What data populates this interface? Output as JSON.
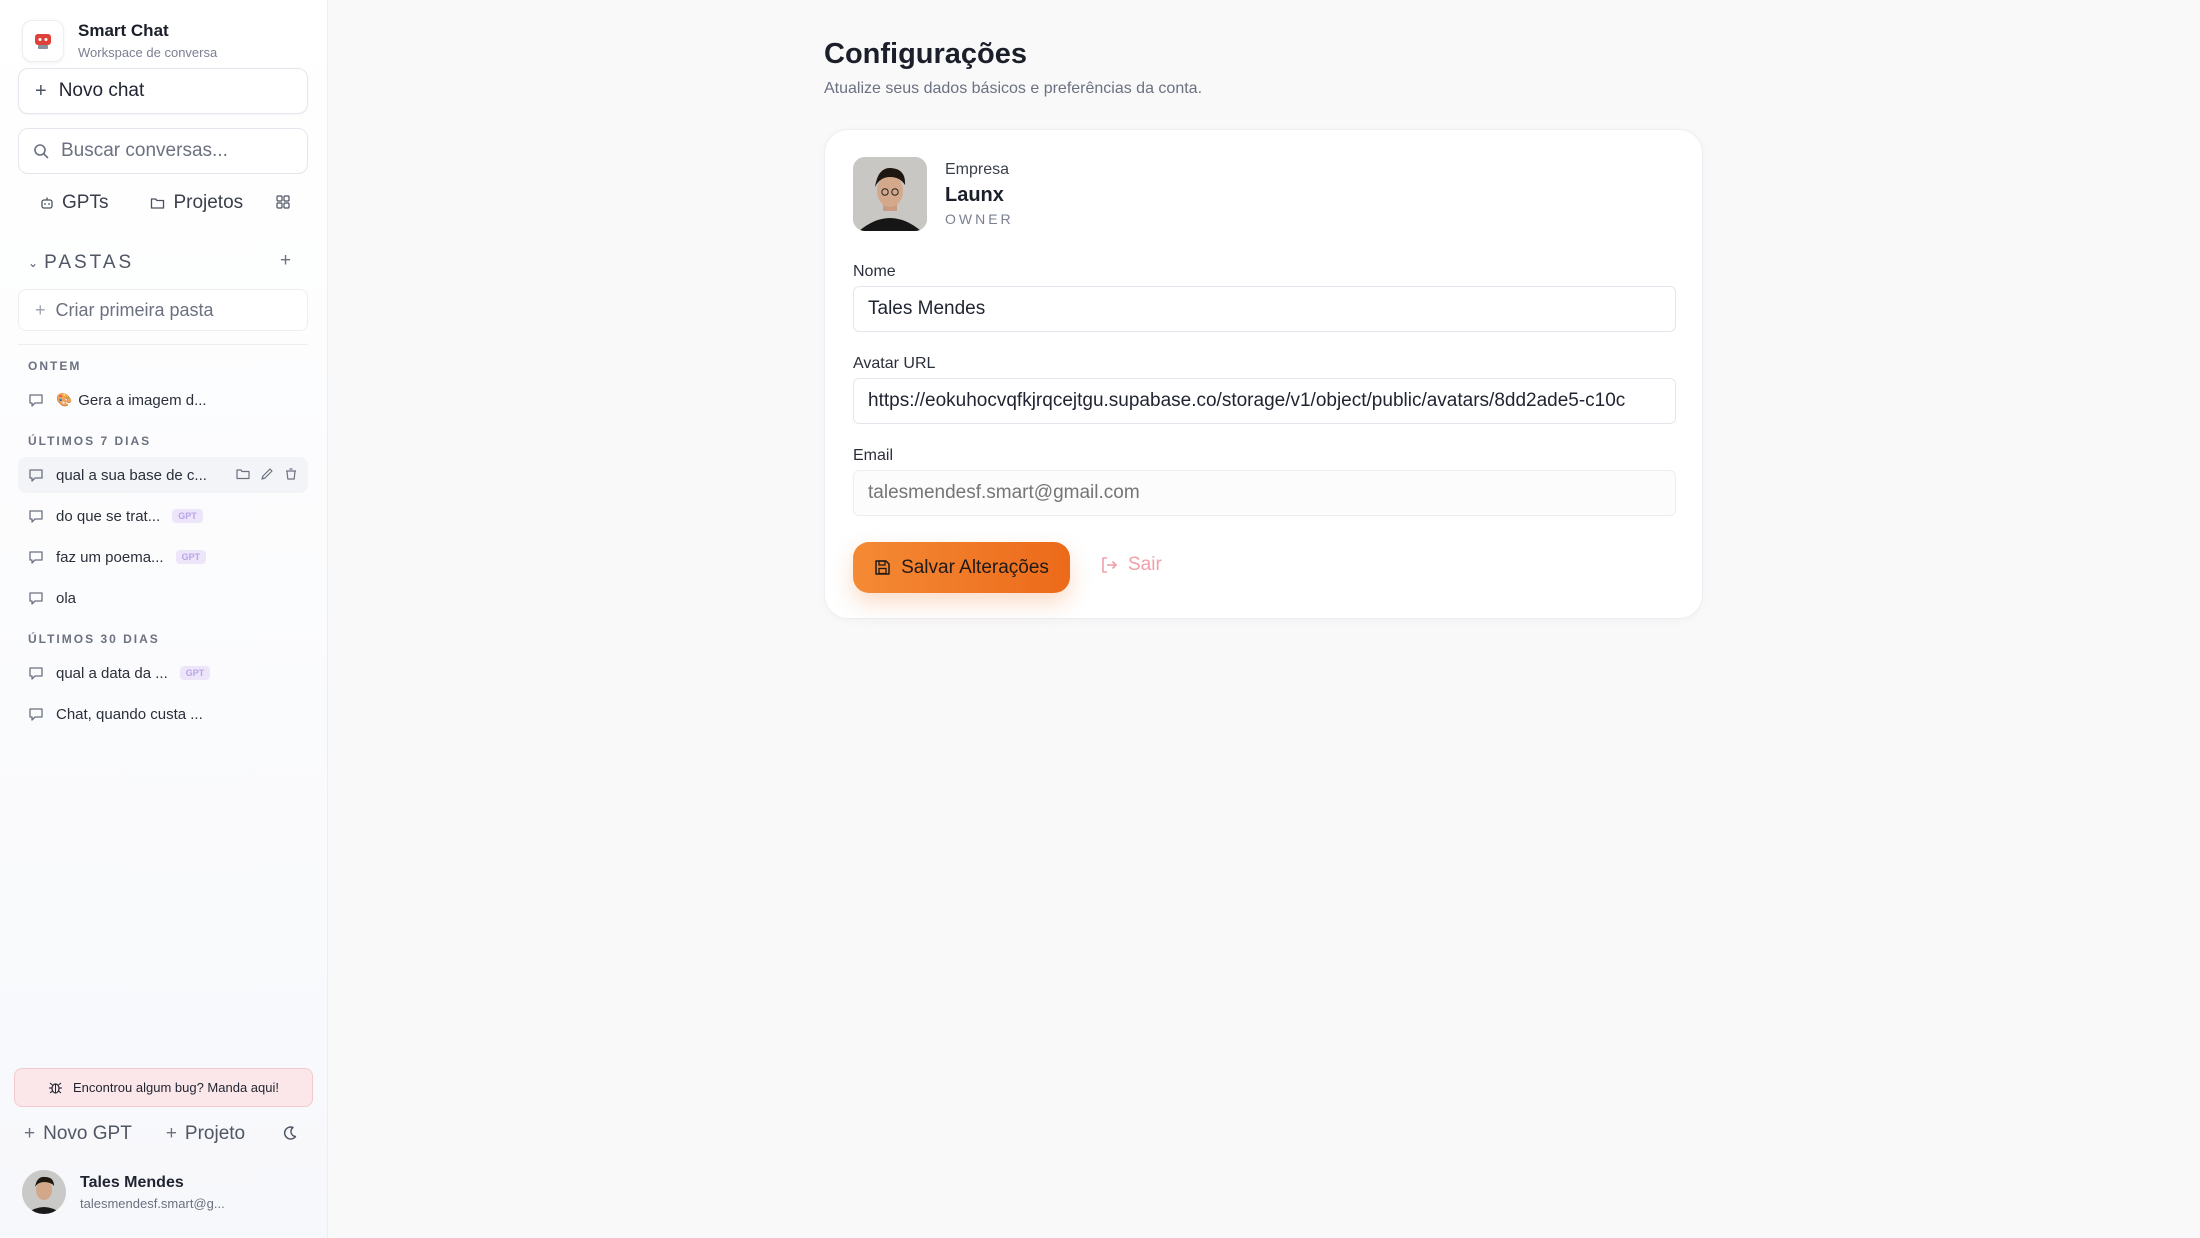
{
  "brand": {
    "title": "Smart Chat",
    "subtitle": "Workspace de conversa",
    "logo_icon": "chat-logo-icon"
  },
  "sidebar": {
    "new_chat_label": "Novo chat",
    "search_placeholder": "Buscar conversas...",
    "quick_links": [
      {
        "label": "GPTs",
        "icon": "robot-icon"
      },
      {
        "label": "Projetos",
        "icon": "folder-icon"
      }
    ],
    "folders_title": "PASTAS",
    "create_folder_label": "Criar primeira pasta",
    "sections": [
      {
        "label": "ONTEM",
        "items": [
          {
            "emoji": "🎨",
            "title": "Gera a imagem d...",
            "gpt": false
          }
        ]
      },
      {
        "label": "ÚLTIMOS 7 DIAS",
        "items": [
          {
            "title": "qual a sua base de c...",
            "gpt": false,
            "active": true
          },
          {
            "title": "do que se trat...",
            "gpt": true
          },
          {
            "title": "faz um poema...",
            "gpt": true
          },
          {
            "title": "ola",
            "gpt": false
          }
        ]
      },
      {
        "label": "ÚLTIMOS 30 DIAS",
        "items": [
          {
            "title": "qual a data da ...",
            "gpt": true
          },
          {
            "title": "Chat, quando custa ...",
            "gpt": false
          }
        ]
      }
    ],
    "gpt_badge": "GPT",
    "bug_report_label": "Encontrou algum bug? Manda aqui!",
    "new_gpt_label": "Novo GPT",
    "new_project_label": "Projeto",
    "user": {
      "name": "Tales Mendes",
      "email": "talesmendesf.smart@g..."
    }
  },
  "settings": {
    "title": "Configurações",
    "subtitle": "Atualize seus dados básicos e preferências da conta.",
    "company_label": "Empresa",
    "company_name": "Launx",
    "role": "OWNER",
    "name_label": "Nome",
    "name_value": "Tales Mendes",
    "avatar_label": "Avatar URL",
    "avatar_value": "https://eokuhocvqfkjrqcejtgu.supabase.co/storage/v1/object/public/avatars/8dd2ade5-c10c",
    "email_label": "Email",
    "email_placeholder": "talesmendesf.smart@gmail.com",
    "save_label": "Salvar Alterações",
    "logout_label": "Sair"
  },
  "colors": {
    "accent": "#f07a2a",
    "logout": "#f0a0a8",
    "gpt_badge_bg": "#ede6fb"
  }
}
